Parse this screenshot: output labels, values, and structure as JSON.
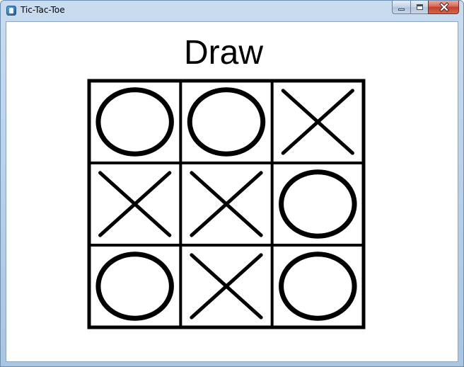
{
  "window": {
    "title": "Tic-Tac-Toe",
    "controls": [
      "minimize",
      "maximize",
      "close"
    ]
  },
  "game": {
    "status": "Draw",
    "board": [
      [
        "O",
        "O",
        "X"
      ],
      [
        "X",
        "X",
        "O"
      ],
      [
        "O",
        "X",
        "O"
      ]
    ]
  }
}
